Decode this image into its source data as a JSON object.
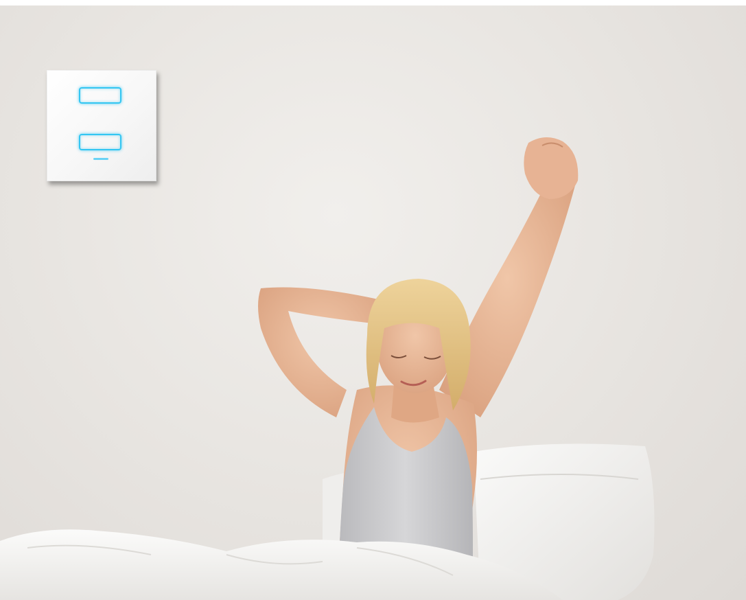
{
  "scene": {
    "description_elements": [
      "wall-switch-panel",
      "woman-stretching",
      "bed-pillows"
    ],
    "colors": {
      "wall": "#e9e6e2",
      "switch_glow": "#33c6f2",
      "skin": "#e8b596",
      "hair": "#e6c98c",
      "tank_top": "#c9c9cc",
      "bedding": "#f4f3f1"
    }
  },
  "switch_panel": {
    "keys": 2
  }
}
